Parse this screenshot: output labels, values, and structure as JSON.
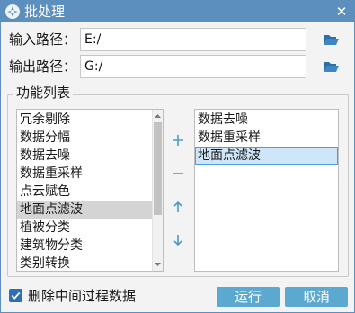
{
  "window": {
    "title": "批处理",
    "close_glyph": "✕"
  },
  "input_path": {
    "label": "输入路径：",
    "value": "E:/"
  },
  "output_path": {
    "label": "输出路径：",
    "value": "G:/"
  },
  "function_list": {
    "title": "功能列表",
    "available": [
      {
        "label": "冗余剔除"
      },
      {
        "label": "数据分幅"
      },
      {
        "label": "数据去噪"
      },
      {
        "label": "数据重采样"
      },
      {
        "label": "点云赋色"
      },
      {
        "label": "地面点滤波"
      },
      {
        "label": "植被分类"
      },
      {
        "label": "建筑物分类"
      },
      {
        "label": "类别转换"
      }
    ],
    "available_selected_index": 5,
    "selected": [
      {
        "label": "数据去噪"
      },
      {
        "label": "数据重采样"
      },
      {
        "label": "地面点滤波"
      }
    ],
    "selected_highlight_index": 2
  },
  "icons": {
    "add": "plus-icon",
    "remove": "minus-icon",
    "up": "arrow-up-icon",
    "down": "arrow-down-icon",
    "folder": "folder-open-icon",
    "app": "app-logo-icon"
  },
  "delete_intermediate": {
    "label": "删除中间过程数据",
    "checked": true
  },
  "buttons": {
    "run": "运行",
    "cancel": "取消"
  },
  "colors": {
    "titlebar": "#5c8fbe",
    "accent_button": "#5ba8d1",
    "checkbox": "#2c6fb2",
    "highlight": "#cfe6f8"
  }
}
